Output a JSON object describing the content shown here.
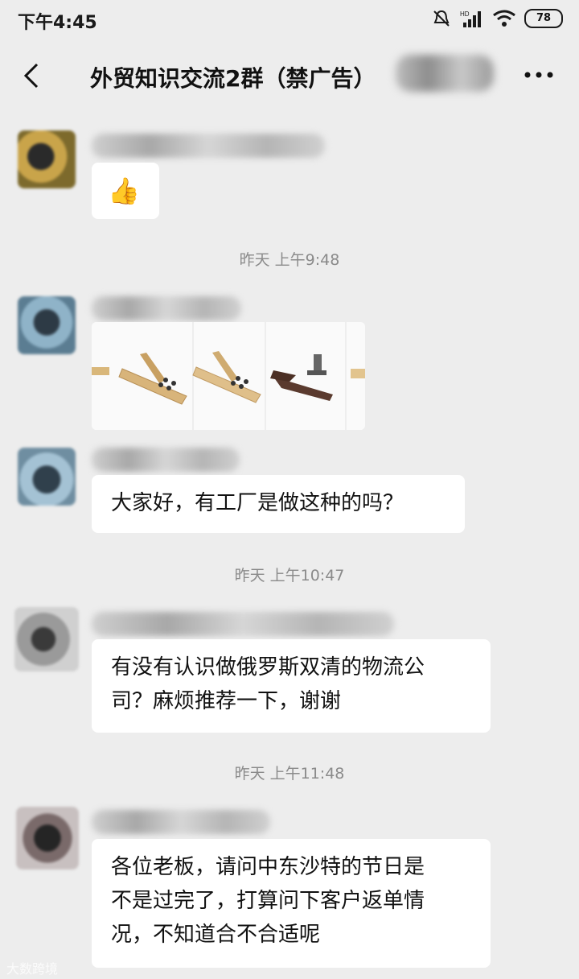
{
  "status_bar": {
    "time": "下午4:45",
    "battery": "78"
  },
  "header": {
    "title": "外贸知识交流2群（禁广告）"
  },
  "timestamps": [
    "昨天 上午9:48",
    "昨天 上午10:47",
    "昨天 上午11:48"
  ],
  "messages": [
    {
      "type": "emoji",
      "content": "👍"
    },
    {
      "type": "image",
      "content": "product images"
    },
    {
      "type": "text",
      "content": "大家好，有工厂是做这种的吗？"
    },
    {
      "type": "text",
      "lines": [
        "有没有认识做俄罗斯双清的物流公",
        "司？麻烦推荐一下，谢谢"
      ]
    },
    {
      "type": "text",
      "lines": [
        "各位老板，请问中东沙特的节日是",
        "不是过完了，打算问下客户返单情",
        "况，不知道合不合适呢"
      ]
    }
  ],
  "watermark": "大数跨境"
}
